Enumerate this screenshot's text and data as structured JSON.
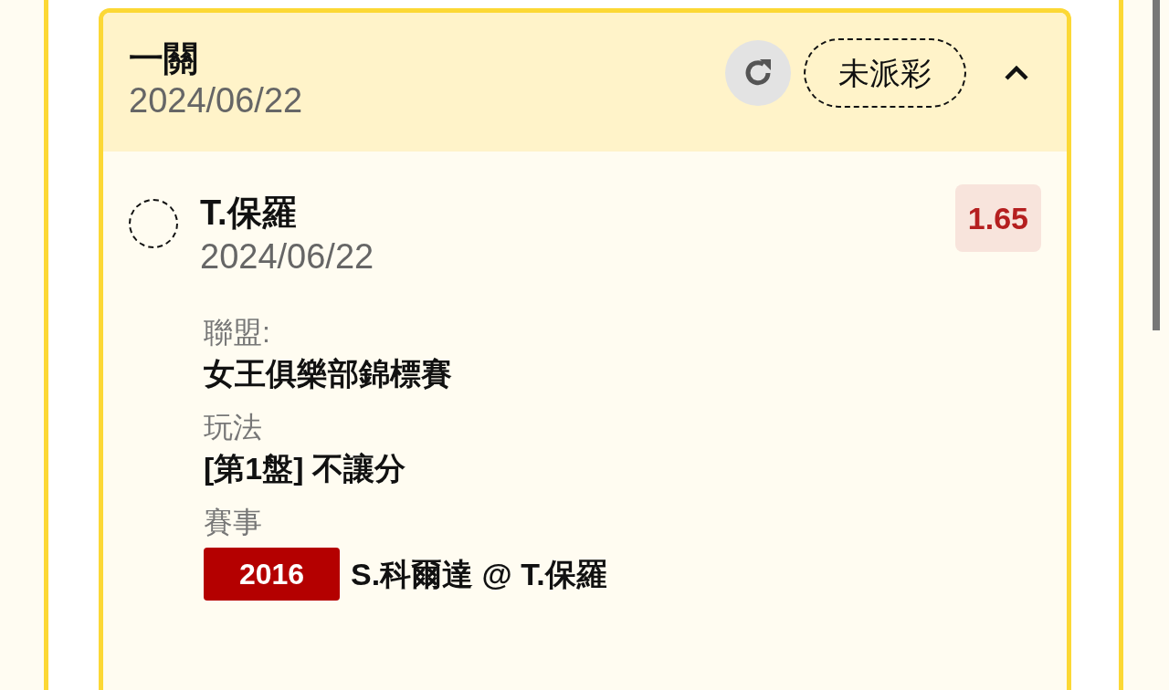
{
  "card": {
    "title": "一關",
    "date": "2024/06/22",
    "status": "未派彩",
    "expanded": true
  },
  "selection": {
    "selected": false,
    "team": "T.保羅",
    "date": "2024/06/22",
    "odds": "1.65"
  },
  "details": [
    {
      "kind": "text",
      "label": "聯盟:",
      "value": "女王俱樂部錦標賽"
    },
    {
      "kind": "text",
      "label": "玩法",
      "value": "[第1盤] 不讓分"
    },
    {
      "kind": "event",
      "label": "賽事",
      "code": "2016",
      "value": "S.科爾達 @ T.保羅"
    }
  ]
}
